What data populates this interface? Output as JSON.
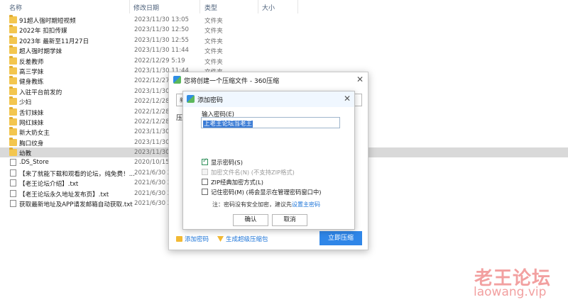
{
  "header": {
    "name": "名称",
    "date": "修改日期",
    "type": "类型",
    "size": "大小"
  },
  "rows": [
    {
      "name": "91超人强时期短视频",
      "date": "2023/11/30 13:05",
      "type": "文件夹",
      "kind": "folder"
    },
    {
      "name": "2022年 扣扣传媒",
      "date": "2023/11/30 12:50",
      "type": "文件夹",
      "kind": "folder"
    },
    {
      "name": "2023年 最新至11月27日",
      "date": "2023/11/30 12:55",
      "type": "文件夹",
      "kind": "folder"
    },
    {
      "name": "超人强时期学妹",
      "date": "2023/11/30 11:44",
      "type": "文件夹",
      "kind": "folder"
    },
    {
      "name": "反差教师",
      "date": "2022/12/29 5:19",
      "type": "文件夹",
      "kind": "folder"
    },
    {
      "name": "高三学妹",
      "date": "2023/11/30 11:44",
      "type": "文件夹",
      "kind": "folder"
    },
    {
      "name": "健身教练",
      "date": "2022/12/27",
      "type": "",
      "kind": "folder"
    },
    {
      "name": "入驻平台前发的",
      "date": "2023/11/30",
      "type": "",
      "kind": "folder"
    },
    {
      "name": "少妇",
      "date": "2022/12/28",
      "type": "",
      "kind": "folder"
    },
    {
      "name": "舌钉妹妹",
      "date": "2022/12/28",
      "type": "",
      "kind": "folder"
    },
    {
      "name": "网红妹妹",
      "date": "2022/12/28",
      "type": "",
      "kind": "folder"
    },
    {
      "name": "新大奶女主",
      "date": "2023/11/30",
      "type": "",
      "kind": "folder"
    },
    {
      "name": "胸口纹身",
      "date": "2023/11/30",
      "type": "",
      "kind": "folder"
    },
    {
      "name": "幼教",
      "date": "2023/11/30",
      "type": "",
      "kind": "folder"
    },
    {
      "name": ".DS_Store",
      "date": "2020/10/15",
      "type": "",
      "kind": "file"
    },
    {
      "name": "【来了就能下载和观看的论坛，纯免费！...",
      "date": "2021/6/30 2",
      "type": "",
      "kind": "file"
    },
    {
      "name": "【老王论坛介绍】.txt",
      "date": "2021/6/30 2",
      "type": "",
      "kind": "file"
    },
    {
      "name": "【老王论坛永久地址发布页】.txt",
      "date": "2021/6/30 2",
      "type": "",
      "kind": "file"
    },
    {
      "name": "获取最新地址及APP请发邮箱自动获取.txt",
      "date": "2021/6/30 2",
      "type": "",
      "kind": "file"
    }
  ],
  "dialog": {
    "title": "您将创建一个压缩文件 - 360压缩",
    "field_text": "新",
    "label": "压",
    "add_password": "添加密码",
    "super_zip": "生成超级压缩包",
    "compress_now": "立即压缩"
  },
  "password_dialog": {
    "title": "添加密码",
    "input_label": "输入密码(E)",
    "input_value": "上老王论坛当老王",
    "options": {
      "show_password": "显示密码(S)",
      "encrypt_names": "加密文件名(N) (不支持ZIP格式)",
      "zip_classic": "ZIP经典加密方式(L)",
      "remember": "记住密码(M) (将会显示在管理密码窗口中)"
    },
    "note": "注：密码没有安全加密，建议先",
    "note_link": "设置主密码",
    "ok": "确认",
    "cancel": "取消"
  },
  "watermark": {
    "cn": "老王论坛",
    "url": "laowang.vip"
  }
}
